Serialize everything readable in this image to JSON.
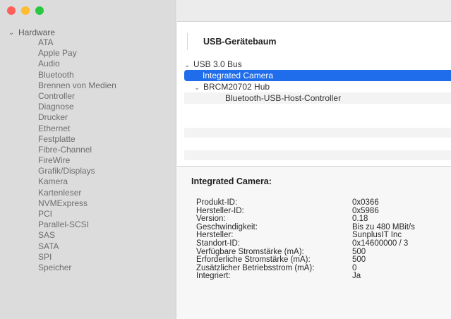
{
  "window": {
    "traffic_lights": {
      "close": "#ff5f57",
      "minimize": "#febc2e",
      "zoom": "#28c840"
    }
  },
  "sidebar": {
    "group_label": "Hardware",
    "items": [
      "ATA",
      "Apple Pay",
      "Audio",
      "Bluetooth",
      "Brennen von Medien",
      "Controller",
      "Diagnose",
      "Drucker",
      "Ethernet",
      "Festplatte",
      "Fibre-Channel",
      "FireWire",
      "Grafik/Displays",
      "Kamera",
      "Kartenleser",
      "NVMExpress",
      "PCI",
      "Parallel-SCSI",
      "SAS",
      "SATA",
      "SPI",
      "Speicher"
    ]
  },
  "tree": {
    "header": "USB-Gerätebaum",
    "rows": [
      {
        "label": "USB 3.0 Bus",
        "level": 0,
        "expanded": true
      },
      {
        "label": "Integrated Camera",
        "level": 1,
        "selected": true
      },
      {
        "label": "BRCM20702 Hub",
        "level": 1,
        "expanded": true
      },
      {
        "label": "Bluetooth-USB-Host-Controller",
        "level": 2
      }
    ],
    "selection_color": "#1f6dea"
  },
  "detail": {
    "title": "Integrated Camera:",
    "properties": [
      {
        "label": "Produkt-ID:",
        "value": "0x0366"
      },
      {
        "label": "Hersteller-ID:",
        "value": "0x5986"
      },
      {
        "label": "Version:",
        "value": "0.18"
      },
      {
        "label": "Geschwindigkeit:",
        "value": "Bis zu 480 MBit/s"
      },
      {
        "label": "Hersteller:",
        "value": "SunplusIT Inc"
      },
      {
        "label": "Standort-ID:",
        "value": "0x14600000 / 3"
      },
      {
        "label": "Verfügbare Stromstärke (mA):",
        "value": "500"
      },
      {
        "label": "Erforderliche Stromstärke (mA):",
        "value": "500"
      },
      {
        "label": "Zusätzlicher Betriebsstrom (mA):",
        "value": "0"
      },
      {
        "label": "Integriert:",
        "value": "Ja"
      }
    ]
  }
}
